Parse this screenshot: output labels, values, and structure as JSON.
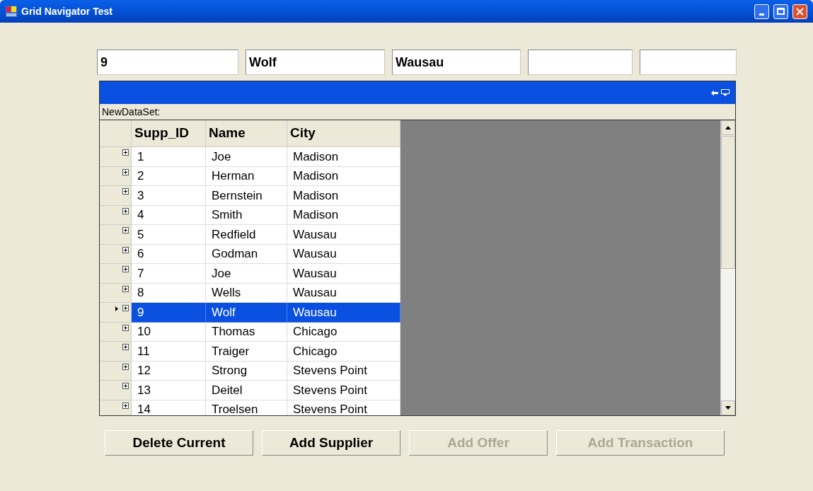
{
  "window": {
    "title": "Grid Navigator Test"
  },
  "fields": [
    {
      "value": "9"
    },
    {
      "value": "Wolf"
    },
    {
      "value": "Wausau"
    }
  ],
  "grid": {
    "caption_title": "NewDataSet:",
    "columns": [
      "Supp_ID",
      "Name",
      "City"
    ],
    "rows": [
      {
        "cells": [
          "1",
          "Joe",
          "Madison"
        ],
        "selected": false
      },
      {
        "cells": [
          "2",
          "Herman",
          "Madison"
        ],
        "selected": false
      },
      {
        "cells": [
          "3",
          "Bernstein",
          "Madison"
        ],
        "selected": false
      },
      {
        "cells": [
          "4",
          "Smith",
          "Madison"
        ],
        "selected": false
      },
      {
        "cells": [
          "5",
          "Redfield",
          "Wausau"
        ],
        "selected": false
      },
      {
        "cells": [
          "6",
          "Godman",
          "Wausau"
        ],
        "selected": false
      },
      {
        "cells": [
          "7",
          "Joe",
          "Wausau"
        ],
        "selected": false
      },
      {
        "cells": [
          "8",
          "Wells",
          "Wausau"
        ],
        "selected": false
      },
      {
        "cells": [
          "9",
          "Wolf",
          "Wausau"
        ],
        "selected": true
      },
      {
        "cells": [
          "10",
          "Thomas",
          "Chicago"
        ],
        "selected": false
      },
      {
        "cells": [
          "11",
          "Traiger",
          "Chicago"
        ],
        "selected": false
      },
      {
        "cells": [
          "12",
          "Strong",
          "Stevens Point"
        ],
        "selected": false
      },
      {
        "cells": [
          "13",
          "Deitel",
          "Stevens Point"
        ],
        "selected": false
      },
      {
        "cells": [
          "14",
          "Troelsen",
          "Stevens Point"
        ],
        "selected": false
      }
    ]
  },
  "buttons": [
    {
      "label": "Delete Current",
      "disabled": false
    },
    {
      "label": "Add Supplier",
      "disabled": false
    },
    {
      "label": "Add Offer",
      "disabled": true
    },
    {
      "label": "Add Transaction",
      "disabled": true
    }
  ]
}
